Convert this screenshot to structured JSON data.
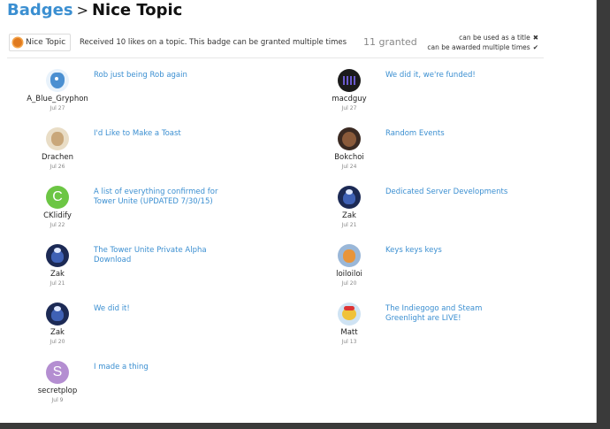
{
  "breadcrumb": {
    "badges_label": "Badges",
    "separator": ">",
    "topic_title": "Nice Topic"
  },
  "badge": {
    "name": "Nice Topic",
    "icon": "sun-badge-icon",
    "description": "Received 10 likes on a topic. This badge can be granted multiple times",
    "granted": "11 granted",
    "flags": [
      {
        "label": "can be used as a title",
        "mark": "✖"
      },
      {
        "label": "can be awarded multiple times",
        "mark": "✔"
      }
    ]
  },
  "colors": {
    "link": "#3b8fd1",
    "badge_icon": "#e07a1f"
  },
  "items": [
    {
      "user": "A_Blue_Gryphon",
      "date": "Jul 27",
      "title": "Rob just being Rob again",
      "avatar": "av-gryphon",
      "letter": ""
    },
    {
      "user": "macdguy",
      "date": "Jul 27",
      "title": "We did it, we're funded!",
      "avatar": "av-macd",
      "letter": ""
    },
    {
      "user": "Drachen",
      "date": "Jul 26",
      "title": "I'd Like to Make a Toast",
      "avatar": "av-drachen",
      "letter": ""
    },
    {
      "user": "Bokchoi",
      "date": "Jul 24",
      "title": "Random Events",
      "avatar": "av-bok",
      "letter": ""
    },
    {
      "user": "CKlidify",
      "date": "Jul 22",
      "title": "A list of everything confirmed for Tower Unite (UPDATED 7/30/15)",
      "avatar": "av-green",
      "letter": "C"
    },
    {
      "user": "Zak",
      "date": "Jul 21",
      "title": "Dedicated Server Developments",
      "avatar": "av-zak",
      "letter": ""
    },
    {
      "user": "Zak",
      "date": "Jul 21",
      "title": "The Tower Unite Private Alpha Download",
      "avatar": "av-zak",
      "letter": ""
    },
    {
      "user": "loiloiloi",
      "date": "Jul 20",
      "title": "Keys keys keys",
      "avatar": "av-loi",
      "letter": ""
    },
    {
      "user": "Zak",
      "date": "Jul 20",
      "title": "We did it!",
      "avatar": "av-zak",
      "letter": ""
    },
    {
      "user": "Matt",
      "date": "Jul 13",
      "title": "The Indiegogo and Steam Greenlight are LIVE!",
      "avatar": "av-matt",
      "letter": ""
    },
    {
      "user": "secretplop",
      "date": "Jul 9",
      "title": "I made a thing",
      "avatar": "av-purple",
      "letter": "S"
    }
  ]
}
